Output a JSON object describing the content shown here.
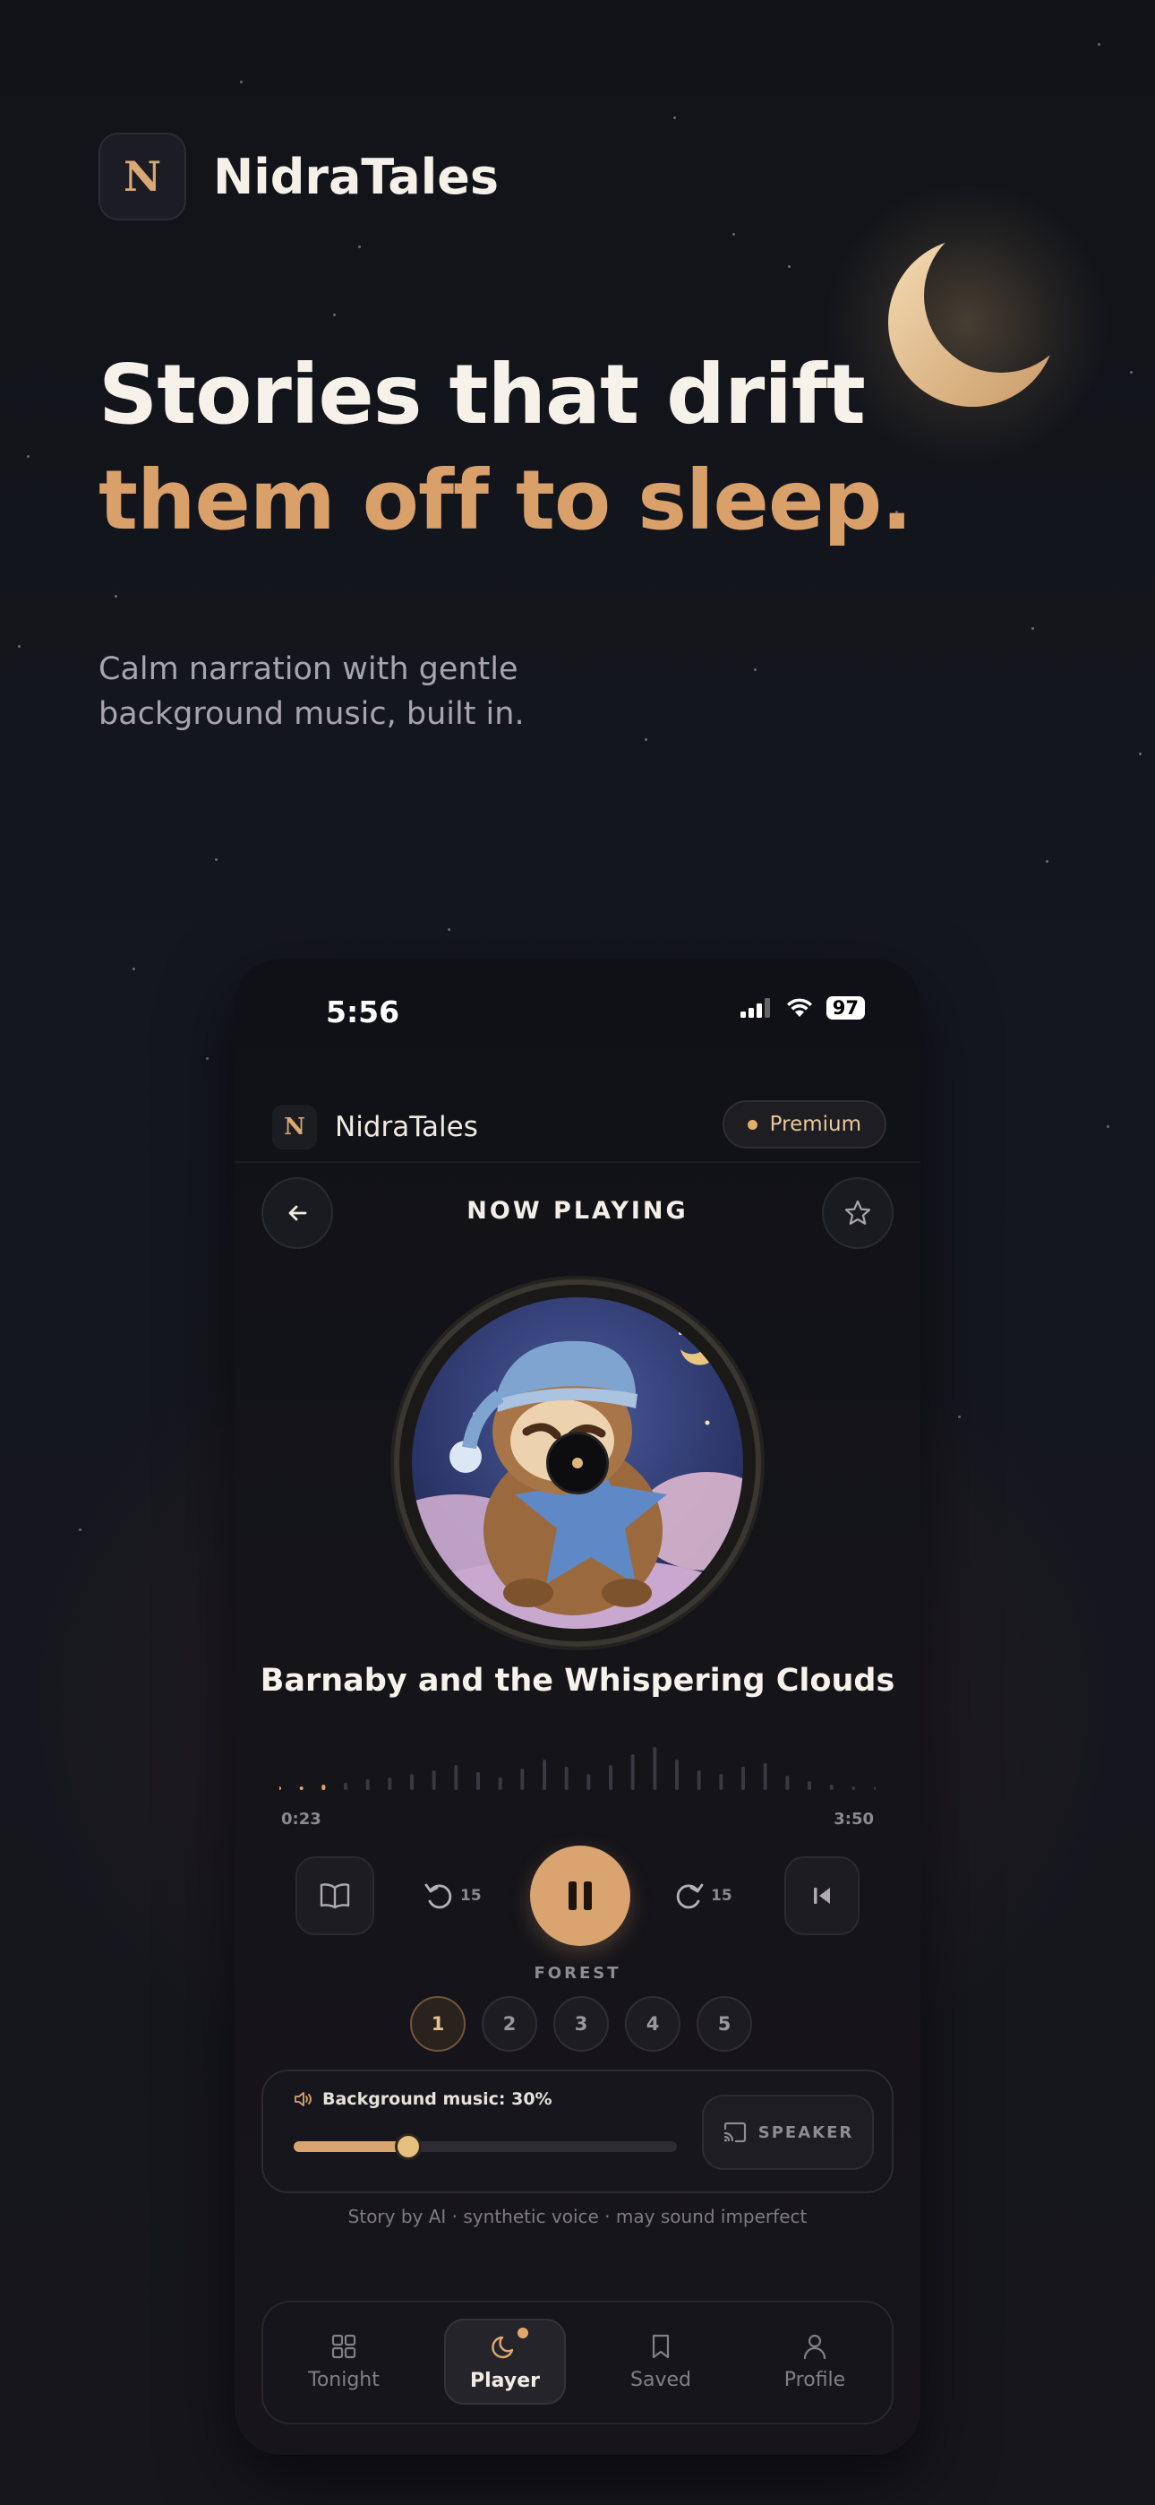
{
  "brand": {
    "logo_letter": "N",
    "name": "NidraTales"
  },
  "hero": {
    "line1": "Stories that drift",
    "line2": "them off to sleep.",
    "subtitle": "Calm narration with gentle background music, built in."
  },
  "phone": {
    "status_bar": {
      "time": "5:56",
      "battery": "97"
    },
    "app_bar": {
      "logo_letter": "N",
      "name": "NidraTales",
      "premium_label": "Premium"
    },
    "header": {
      "title": "NOW PLAYING",
      "back_icon": "arrow-left-icon",
      "favorite_icon": "star-icon"
    },
    "track": {
      "title": "Barnaby and the Whispering Clouds",
      "elapsed": "0:23",
      "duration": "3:50",
      "progress": 0.1
    },
    "controls": {
      "rewind_seconds": "15",
      "forward_seconds": "15",
      "state": "playing"
    },
    "soundscape": {
      "label": "FOREST",
      "options": [
        "1",
        "2",
        "3",
        "4",
        "5"
      ],
      "selected": "1"
    },
    "background_music": {
      "label": "Background music: 30%",
      "level": 0.3,
      "speaker_label": "SPEAKER"
    },
    "disclaimer": "Story by AI · synthetic voice · may sound imperfect",
    "tabs": [
      {
        "label": "Tonight",
        "icon": "grid-icon"
      },
      {
        "label": "Player",
        "icon": "moon-icon",
        "active": true
      },
      {
        "label": "Saved",
        "icon": "bookmark-icon"
      },
      {
        "label": "Profile",
        "icon": "user-icon"
      }
    ]
  },
  "colors": {
    "accent": "#d9a46f",
    "background": "#111318",
    "text": "#f6f1e9"
  }
}
